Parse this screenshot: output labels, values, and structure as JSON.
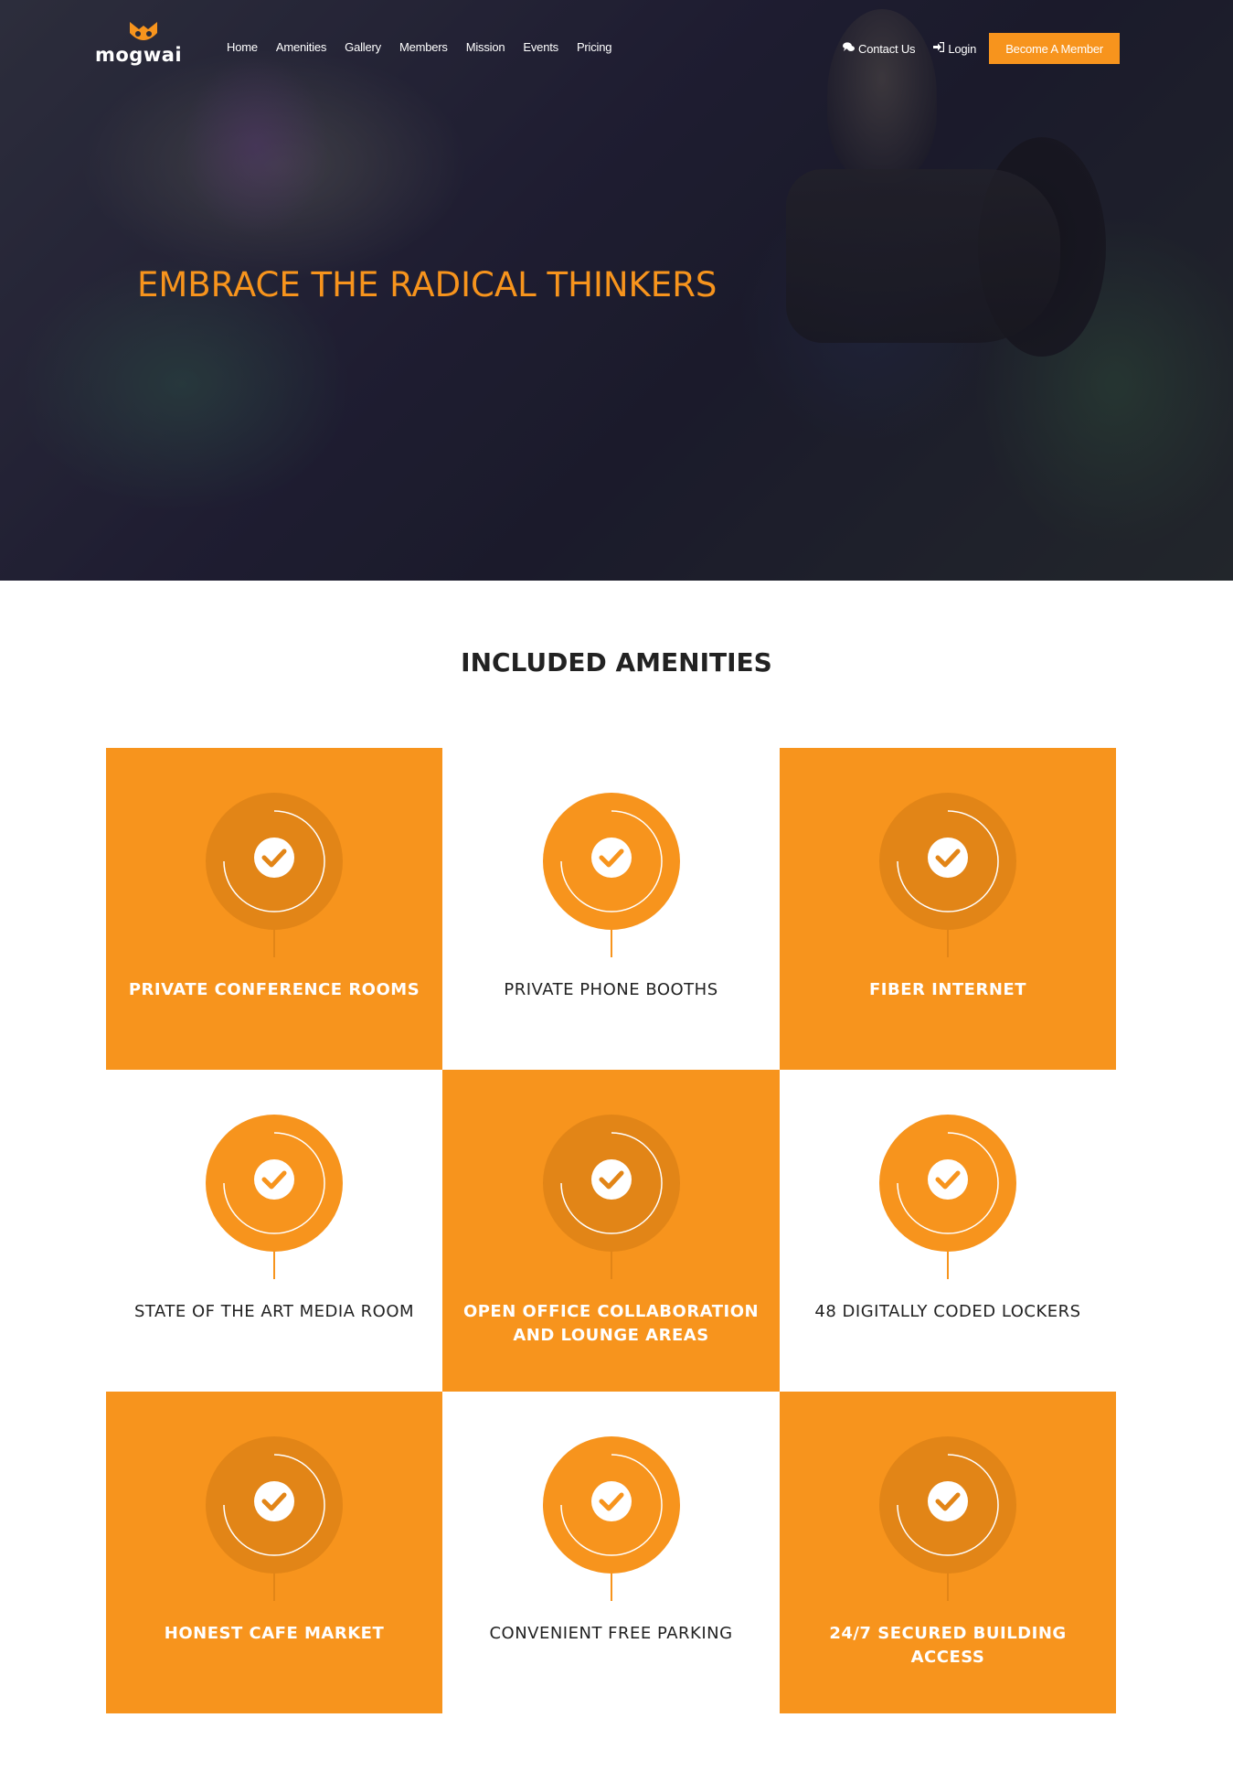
{
  "nav": {
    "logo_text": "mogwai",
    "menu": [
      {
        "label": "Home"
      },
      {
        "label": "Amenities"
      },
      {
        "label": "Gallery"
      },
      {
        "label": "Members"
      },
      {
        "label": "Mission"
      },
      {
        "label": "Events"
      },
      {
        "label": "Pricing"
      }
    ],
    "contact_label": "Contact Us",
    "contact_icon": "chat-bubbles-icon",
    "login_label": "Login",
    "login_icon": "sign-in-icon",
    "cta_label": "Become A Member"
  },
  "hero": {
    "title": "EMBRACE THE RADICAL THINKERS"
  },
  "amenities": {
    "title": "INCLUDED AMENITIES",
    "items": [
      {
        "label": "PRIVATE CONFERENCE ROOMS",
        "style": "orange"
      },
      {
        "label": "PRIVATE PHONE BOOTHS",
        "style": "white"
      },
      {
        "label": "FIBER INTERNET",
        "style": "orange"
      },
      {
        "label": "STATE OF THE ART MEDIA ROOM",
        "style": "white"
      },
      {
        "label": "OPEN OFFICE COLLABORATION AND LOUNGE AREAS",
        "style": "orange"
      },
      {
        "label": "48 DIGITALLY CODED LOCKERS",
        "style": "white"
      },
      {
        "label": "HONEST CAFE MARKET",
        "style": "orange"
      },
      {
        "label": "CONVENIENT FREE PARKING",
        "style": "white"
      },
      {
        "label": "24/7 SECURED BUILDING ACCESS",
        "style": "orange"
      }
    ]
  },
  "colors": {
    "accent": "#f7941d",
    "accent_dark": "#e28517",
    "text_dark": "#222222"
  }
}
